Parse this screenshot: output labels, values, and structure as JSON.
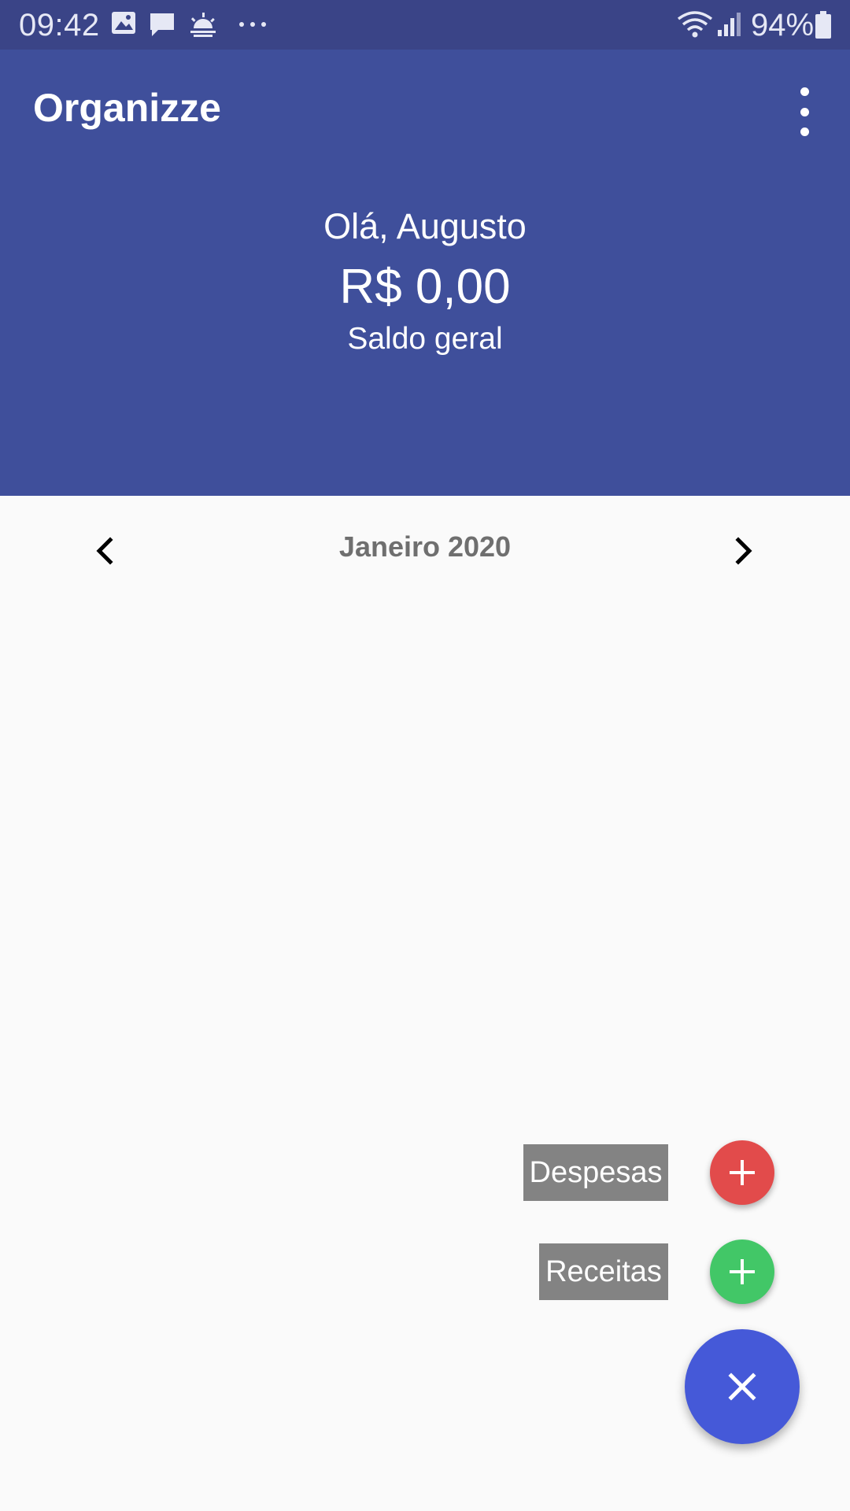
{
  "status_bar": {
    "time": "09:42",
    "battery": "94%",
    "icons": [
      "image-icon",
      "message-icon",
      "weather-icon",
      "more-dots-icon",
      "wifi-icon",
      "signal-icon",
      "battery-icon"
    ]
  },
  "app_bar": {
    "title": "Organizze",
    "menu_icon": "more-vert-icon"
  },
  "header": {
    "greeting": "Olá, Augusto",
    "balance": "R$ 0,00",
    "balance_label": "Saldo geral"
  },
  "month_nav": {
    "month": "Janeiro 2020",
    "prev_icon": "chevron-left-icon",
    "next_icon": "chevron-right-icon"
  },
  "fab_menu": {
    "expense_label": "Despesas",
    "income_label": "Receitas",
    "expense_color": "#e24b4b",
    "income_color": "#42c767",
    "main_color": "#4559d8",
    "main_icon": "close-icon"
  },
  "colors": {
    "status_bar": "#3a4487",
    "app_bar": "#3f4f9b",
    "background": "#fafafa"
  }
}
